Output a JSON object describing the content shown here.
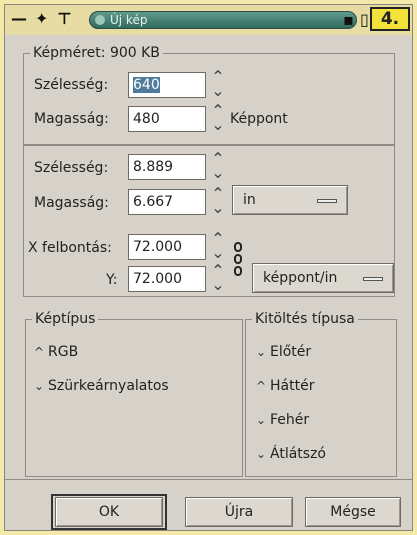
{
  "window": {
    "title": "Új kép",
    "step_badge": "4.",
    "titlebar_left_glyphs": [
      "—",
      "✦",
      "⊤"
    ],
    "titlebar_right_glyphs": [
      "▪",
      "▯"
    ]
  },
  "size_group": {
    "legend": "Képméret: 900 KB",
    "width_label": "Szélesség:",
    "width_value": "640",
    "height_label": "Magasság:",
    "height_value": "480",
    "unit_label": "Képpont"
  },
  "physical": {
    "width_label": "Szélesség:",
    "width_value": "8.889",
    "height_label": "Magasság:",
    "height_value": "6.667",
    "unit_select": "in",
    "xres_label": "X felbontás:",
    "xres_value": "72.000",
    "yres_label": "Y:",
    "yres_value": "72.000",
    "res_unit_select": "képpont/in"
  },
  "image_type": {
    "legend": "Képtípus",
    "options": [
      "RGB",
      "Szürkeárnyalatos"
    ],
    "selected": "RGB"
  },
  "fill_type": {
    "legend": "Kitöltés típusa",
    "options": [
      "Előtér",
      "Háttér",
      "Fehér",
      "Átlátszó"
    ],
    "selected": "Háttér"
  },
  "buttons": {
    "ok": "OK",
    "reset": "Újra",
    "cancel": "Mégse"
  }
}
